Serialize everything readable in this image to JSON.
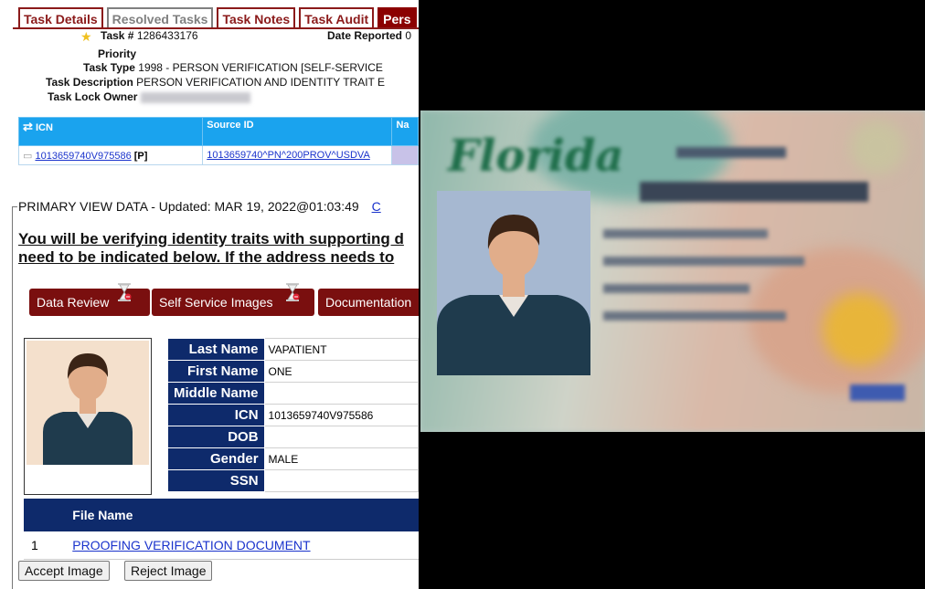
{
  "tabs": [
    {
      "label": "Task Details",
      "state": "default"
    },
    {
      "label": "Resolved Tasks",
      "state": "grey"
    },
    {
      "label": "Task Notes",
      "state": "default"
    },
    {
      "label": "Task Audit",
      "state": "default"
    },
    {
      "label": "Pers",
      "state": "active"
    }
  ],
  "task": {
    "number_label": "Task #",
    "number": "1286433176",
    "date_reported_label": "Date Reported",
    "date_reported_value": "0",
    "priority_label": "Priority",
    "type_label": "Task Type",
    "type_value": "1998 - PERSON VERIFICATION  [SELF-SERVICE",
    "description_label": "Task Description",
    "description_value": "PERSON VERIFICATION AND IDENTITY TRAIT E",
    "lock_owner_label": "Task Lock Owner"
  },
  "icn_table": {
    "headers": [
      "ICN",
      "Source ID",
      "Na"
    ],
    "row": {
      "icn": "1013659740V975586",
      "icn_flag": "[P]",
      "source_id": "1013659740^PN^200PROV^USDVA"
    }
  },
  "primary_view": {
    "title": "PRIMARY VIEW DATA - Updated: MAR 19, 2022@01:03:49",
    "trailing": "C",
    "instructions_line1": "You will be verifying identity traits with supporting d",
    "instructions_line2": "need to be indicated below. If the address needs to"
  },
  "action_buttons": {
    "data_review": "Data Review",
    "self_service_images": "Self Service Images",
    "documentation": "Documentation"
  },
  "traits": [
    {
      "label": "Last Name",
      "value": "VAPATIENT"
    },
    {
      "label": "First Name",
      "value": "ONE"
    },
    {
      "label": "Middle Name",
      "value": ""
    },
    {
      "label": "ICN",
      "value": "1013659740V975586"
    },
    {
      "label": "DOB",
      "value": ""
    },
    {
      "label": "Gender",
      "value": "MALE"
    },
    {
      "label": "SSN",
      "value": ""
    }
  ],
  "files": {
    "header_number": "",
    "header_name": "File Name",
    "rows": [
      {
        "index": "1",
        "name": "PROOFING VERIFICATION DOCUMENT"
      }
    ]
  },
  "image_buttons": {
    "accept": "Accept Image",
    "reject": "Reject Image"
  },
  "id_card": {
    "state_name": "Florida"
  },
  "colors": {
    "tab_red": "#8b1a1a",
    "header_blue": "#1aa3ee",
    "navy": "#0e2a6b",
    "button_maroon": "#7a0f0f"
  }
}
